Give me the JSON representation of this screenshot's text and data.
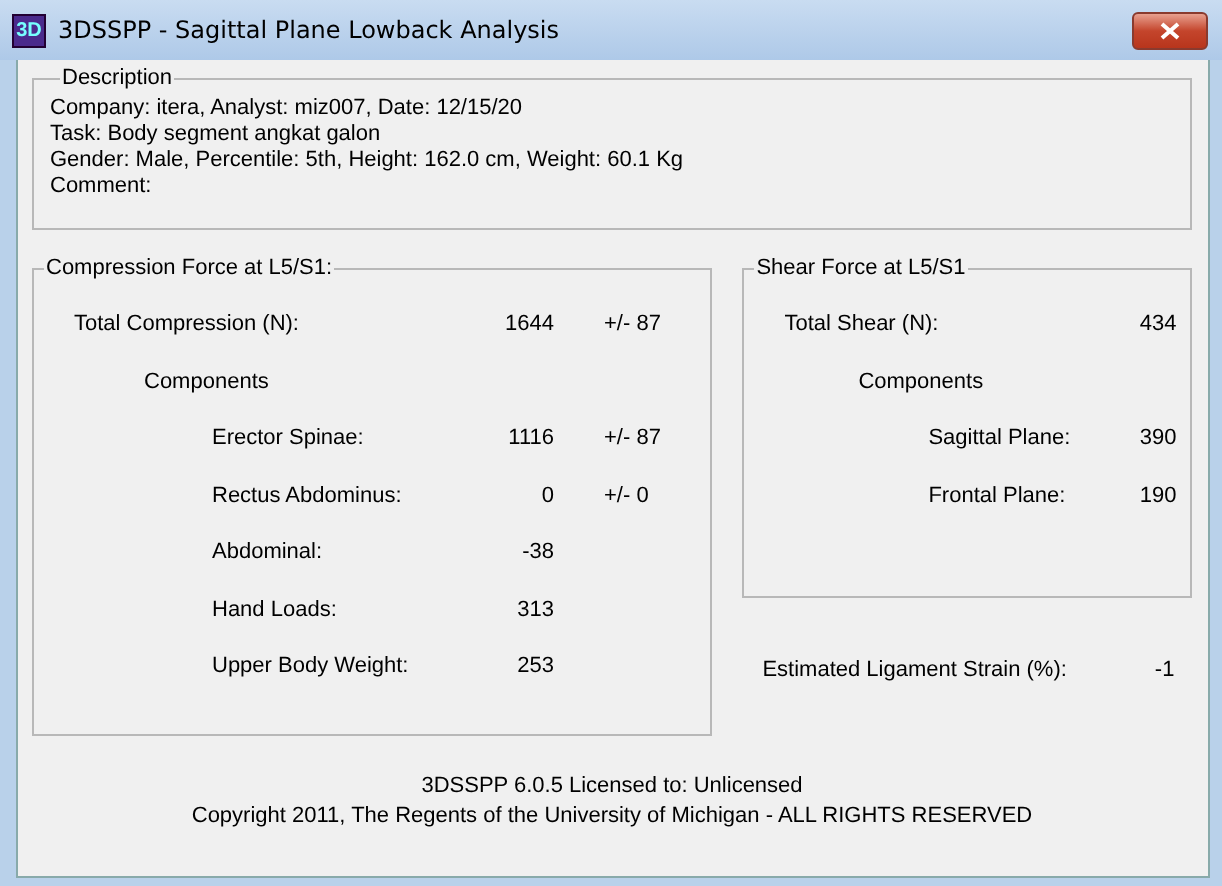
{
  "window": {
    "title": "3DSSPP - Sagittal Plane Lowback Analysis",
    "icon_text": "3D"
  },
  "description": {
    "title": "Description",
    "lines": [
      "Company: itera, Analyst: miz007, Date: 12/15/20",
      "Task: Body segment angkat galon",
      "Gender: Male, Percentile: 5th, Height: 162.0 cm, Weight: 60.1 Kg",
      "Comment:"
    ]
  },
  "compression": {
    "title": "Compression Force at L5/S1:",
    "rows": [
      {
        "label": "Total Compression (N):",
        "value": "1644",
        "error": "+/- 87"
      },
      {
        "label": "Components",
        "children": [
          {
            "label": "Erector Spinae:",
            "value": "1116",
            "error": "+/- 87"
          },
          {
            "label": "Rectus Abdominus:",
            "value": "0",
            "error": "+/- 0"
          },
          {
            "label": "Abdominal:",
            "value": "-38"
          },
          {
            "label": "Hand Loads:",
            "value": "313"
          },
          {
            "label": "Upper Body Weight:",
            "value": "253"
          }
        ]
      }
    ]
  },
  "shear": {
    "title": "Shear Force at L5/S1",
    "rows": [
      {
        "label": "Total Shear (N):",
        "value": "434"
      },
      {
        "label": "Components",
        "children": [
          {
            "label": "Sagittal Plane:",
            "value": "390"
          },
          {
            "label": "Frontal Plane:",
            "value": "190"
          }
        ]
      }
    ]
  },
  "ligament_strain": {
    "label": "Estimated Ligament Strain (%):",
    "value": "-1"
  },
  "footer": [
    "3DSSPP 6.0.5 Licensed to: Unlicensed",
    "Copyright 2011, The Regents of the University of Michigan - ALL RIGHTS RESERVED"
  ]
}
